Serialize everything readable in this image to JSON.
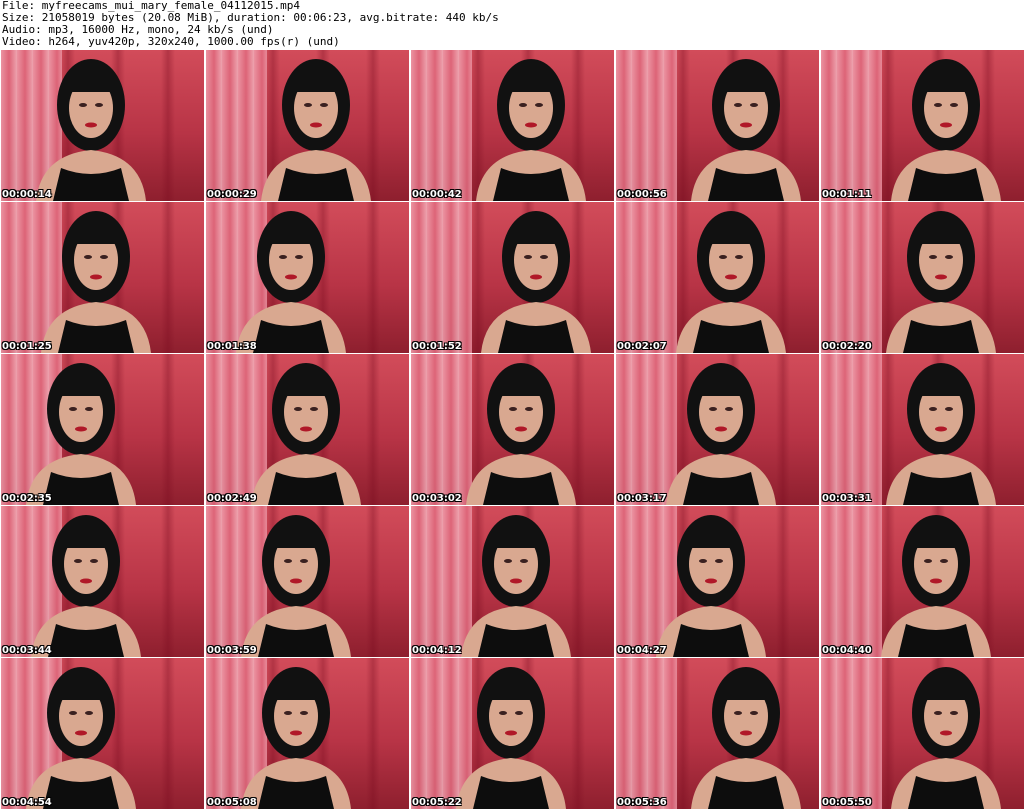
{
  "header": {
    "file_line": "File: myfreecams_mui_mary_female_04112015.mp4",
    "size_line": "Size: 21058019 bytes (20.08 MiB), duration: 00:06:23, avg.bitrate: 440 kb/s",
    "audio_line": "Audio: mp3, 16000 Hz, mono, 24 kb/s (und)",
    "video_line": "Video: h264, yuv420p, 320x240, 1000.00 fps(r) (und)"
  },
  "thumbnails": [
    {
      "timestamp": "00:00:14"
    },
    {
      "timestamp": "00:00:29"
    },
    {
      "timestamp": "00:00:42"
    },
    {
      "timestamp": "00:00:56"
    },
    {
      "timestamp": "00:01:11"
    },
    {
      "timestamp": "00:01:25"
    },
    {
      "timestamp": "00:01:38"
    },
    {
      "timestamp": "00:01:52"
    },
    {
      "timestamp": "00:02:07"
    },
    {
      "timestamp": "00:02:20"
    },
    {
      "timestamp": "00:02:35"
    },
    {
      "timestamp": "00:02:49"
    },
    {
      "timestamp": "00:03:02"
    },
    {
      "timestamp": "00:03:17"
    },
    {
      "timestamp": "00:03:31"
    },
    {
      "timestamp": "00:03:44"
    },
    {
      "timestamp": "00:03:59"
    },
    {
      "timestamp": "00:04:12"
    },
    {
      "timestamp": "00:04:27"
    },
    {
      "timestamp": "00:04:40"
    },
    {
      "timestamp": "00:04:54"
    },
    {
      "timestamp": "00:05:08"
    },
    {
      "timestamp": "00:05:22"
    },
    {
      "timestamp": "00:05:36"
    },
    {
      "timestamp": "00:05:50"
    }
  ],
  "colors": {
    "background": "#ffffff",
    "curtain_red": "#c23a4c",
    "curtain_pink": "#f0a0ae",
    "hair": "#111111",
    "skin": "#d9a890",
    "top": "#0d0d0d"
  }
}
